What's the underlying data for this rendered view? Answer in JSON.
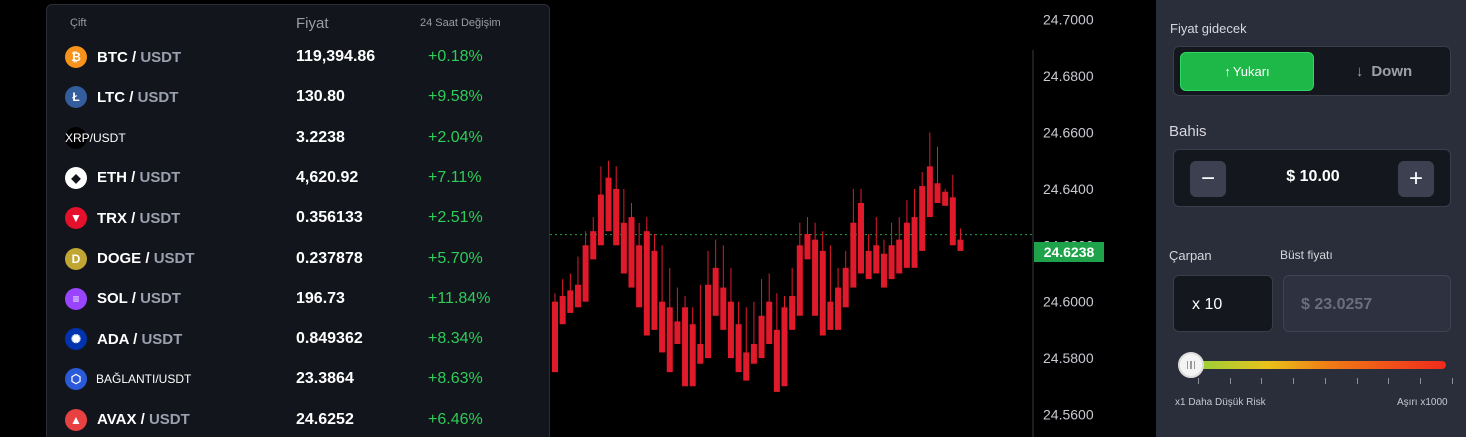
{
  "pair_list": {
    "headers": {
      "pair": "Çift",
      "price": "Fiyat",
      "change": "24 Saat Değişim"
    },
    "rows": [
      {
        "base": "BTC",
        "sep": " / ",
        "quote": "USDT",
        "price": "119,394.86",
        "change": "+0.18%",
        "icon": "btc-icon",
        "icon_color": "#f7931a",
        "icon_glyph": "₿"
      },
      {
        "base": "LTC",
        "sep": " / ",
        "quote": "USDT",
        "price": "130.80",
        "change": "+9.58%",
        "icon": "ltc-icon",
        "icon_color": "#345d9d",
        "icon_glyph": "Ł"
      },
      {
        "label": "XRP/USDT",
        "price": "3.2238",
        "change": "+2.04%",
        "icon": "xrp-icon",
        "icon_color": "#000000",
        "icon_glyph": ""
      },
      {
        "base": "ETH",
        "sep": " / ",
        "quote": "USDT",
        "price": "4,620.92",
        "change": "+7.11%",
        "icon": "eth-icon",
        "icon_color": "#ffffff",
        "icon_glyph": "◆"
      },
      {
        "base": "TRX",
        "sep": " / ",
        "quote": "USDT",
        "price": "0.356133",
        "change": "+2.51%",
        "icon": "trx-icon",
        "icon_color": "#e5102b",
        "icon_glyph": "▼"
      },
      {
        "base": "DOGE",
        "sep": " / ",
        "quote": "USDT",
        "price": "0.237878",
        "change": "+5.70%",
        "icon": "doge-icon",
        "icon_color": "#c2a633",
        "icon_glyph": "D"
      },
      {
        "base": "SOL",
        "sep": " / ",
        "quote": "USDT",
        "price": "196.73",
        "change": "+11.84%",
        "icon": "sol-icon",
        "icon_color": "#9945ff",
        "icon_glyph": "≡"
      },
      {
        "base": "ADA",
        "sep": " / ",
        "quote": "USDT",
        "price": "0.849362",
        "change": "+8.34%",
        "icon": "ada-icon",
        "icon_color": "#0033ad",
        "icon_glyph": "✺"
      },
      {
        "label": "BAĞLANTI/USDT",
        "price": "23.3864",
        "change": "+8.63%",
        "icon": "link-icon",
        "icon_color": "#2a5ada",
        "icon_glyph": "⬡"
      },
      {
        "base": "AVAX",
        "sep": " / ",
        "quote": "USDT",
        "price": "24.6252",
        "change": "+6.46%",
        "icon": "avax-icon",
        "icon_color": "#e84142",
        "icon_glyph": "▲"
      }
    ]
  },
  "chart": {
    "price_axis": [
      "24.7000",
      "24.6800",
      "24.6600",
      "24.6400",
      "24.6200",
      "24.6000",
      "24.5800",
      "24.5600"
    ],
    "current_price": "24.6238",
    "up_color": "#1fa34a",
    "down_color": "#e01a2b"
  },
  "chart_data": {
    "type": "candlestick",
    "ylim": [
      24.552,
      24.707
    ],
    "current": 24.6238,
    "candles": [
      [
        24.6,
        24.603,
        24.58,
        24.575
      ],
      [
        24.602,
        24.608,
        24.598,
        24.592
      ],
      [
        24.604,
        24.61,
        24.6,
        24.596
      ],
      [
        24.606,
        24.616,
        24.603,
        24.598
      ],
      [
        24.62,
        24.625,
        24.604,
        24.6
      ],
      [
        24.625,
        24.63,
        24.619,
        24.615
      ],
      [
        24.638,
        24.648,
        24.624,
        24.62
      ],
      [
        24.644,
        24.65,
        24.63,
        24.625
      ],
      [
        24.64,
        24.648,
        24.622,
        24.62
      ],
      [
        24.628,
        24.64,
        24.622,
        24.61
      ],
      [
        24.63,
        24.635,
        24.612,
        24.605
      ],
      [
        24.62,
        24.628,
        24.61,
        24.598
      ],
      [
        24.625,
        24.63,
        24.6,
        24.588
      ],
      [
        24.618,
        24.624,
        24.602,
        24.59
      ],
      [
        24.6,
        24.62,
        24.588,
        24.582
      ],
      [
        24.598,
        24.612,
        24.585,
        24.575
      ],
      [
        24.593,
        24.605,
        24.59,
        24.585
      ],
      [
        24.598,
        24.602,
        24.58,
        24.57
      ],
      [
        24.592,
        24.598,
        24.575,
        24.57
      ],
      [
        24.585,
        24.606,
        24.582,
        24.578
      ],
      [
        24.606,
        24.618,
        24.585,
        24.58
      ],
      [
        24.612,
        24.622,
        24.6,
        24.595
      ],
      [
        24.605,
        24.62,
        24.595,
        24.59
      ],
      [
        24.6,
        24.612,
        24.585,
        24.58
      ],
      [
        24.592,
        24.6,
        24.582,
        24.575
      ],
      [
        24.582,
        24.598,
        24.578,
        24.572
      ],
      [
        24.585,
        24.6,
        24.583,
        24.578
      ],
      [
        24.595,
        24.608,
        24.585,
        24.58
      ],
      [
        24.6,
        24.61,
        24.59,
        24.585
      ],
      [
        24.59,
        24.603,
        24.572,
        24.568
      ],
      [
        24.598,
        24.602,
        24.575,
        24.57
      ],
      [
        24.602,
        24.612,
        24.594,
        24.59
      ],
      [
        24.62,
        24.628,
        24.6,
        24.595
      ],
      [
        24.624,
        24.63,
        24.62,
        24.615
      ],
      [
        24.622,
        24.628,
        24.6,
        24.595
      ],
      [
        24.618,
        24.625,
        24.595,
        24.588
      ],
      [
        24.6,
        24.62,
        24.595,
        24.59
      ],
      [
        24.605,
        24.612,
        24.596,
        24.59
      ],
      [
        24.612,
        24.618,
        24.6,
        24.598
      ],
      [
        24.628,
        24.64,
        24.61,
        24.605
      ],
      [
        24.635,
        24.64,
        24.615,
        24.61
      ],
      [
        24.618,
        24.624,
        24.612,
        24.608
      ],
      [
        24.62,
        24.63,
        24.615,
        24.61
      ],
      [
        24.617,
        24.622,
        24.612,
        24.605
      ],
      [
        24.62,
        24.628,
        24.614,
        24.608
      ],
      [
        24.622,
        24.63,
        24.614,
        24.61
      ],
      [
        24.628,
        24.636,
        24.618,
        24.612
      ],
      [
        24.63,
        24.64,
        24.617,
        24.612
      ],
      [
        24.641,
        24.646,
        24.622,
        24.618
      ],
      [
        24.648,
        24.66,
        24.636,
        24.63
      ],
      [
        24.642,
        24.655,
        24.64,
        24.635
      ],
      [
        24.639,
        24.64,
        24.638,
        24.634
      ],
      [
        24.637,
        24.645,
        24.624,
        24.62
      ],
      [
        24.622,
        24.626,
        24.621,
        24.618
      ]
    ]
  },
  "control_panel": {
    "direction_label": "Fiyat gidecek",
    "up_label": "Yukarı",
    "down_label": "Down",
    "bet_label": "Bahis",
    "bet_value": "$ 10.00",
    "multiplier_label": "Çarpan",
    "multiplier_value": "x 10",
    "bust_label": "Büst fiyatı",
    "bust_value": "$ 23.0257",
    "risk_level": 0.0,
    "risk_min_label": "x1 Daha Düşük Risk",
    "risk_max_label": "Aşırı x1000"
  }
}
